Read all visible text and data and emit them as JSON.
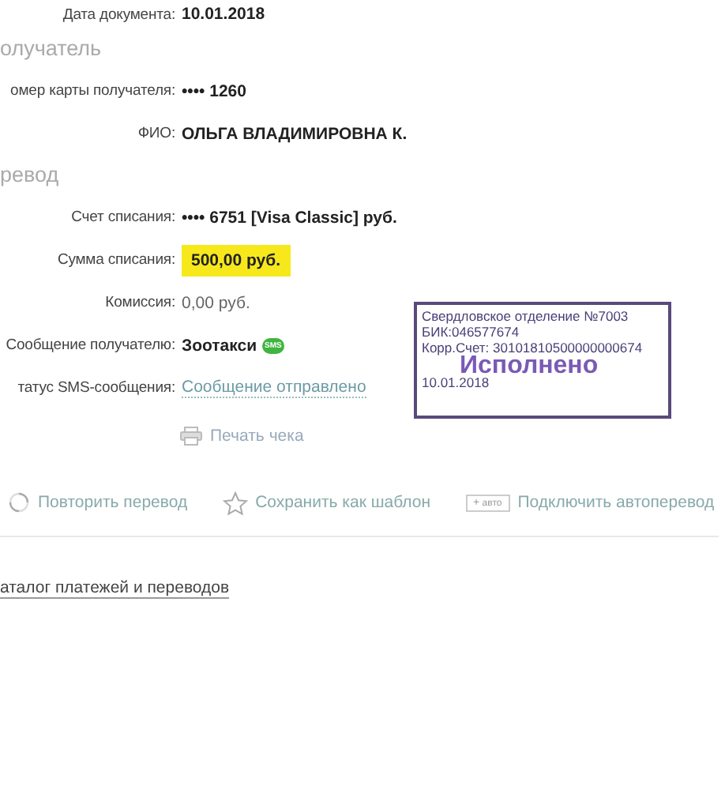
{
  "blocks": [
    {
      "kind": "text",
      "label": "Дата документа:",
      "value": "10.01.2018"
    },
    {
      "kind": "heading",
      "title": "олучатель"
    },
    {
      "kind": "text",
      "label": "омер карты получателя:",
      "value": "•••• 1260"
    },
    {
      "kind": "text",
      "label": "ФИО:",
      "value": "ОЛЬГА ВЛАДИМИРОВНА К."
    },
    {
      "kind": "heading",
      "title": "ревод"
    },
    {
      "kind": "text",
      "label": "Счет списания:",
      "value": "•••• 6751  [Visa Classic]  руб."
    },
    {
      "kind": "amount",
      "label": "Сумма списания:",
      "value": "500,00  руб."
    },
    {
      "kind": "fee",
      "label": "Комиссия:",
      "value": "0,00 руб."
    },
    {
      "kind": "message",
      "label": "Сообщение получателю:",
      "value": "Зоотакси",
      "icon_text": "SMS"
    },
    {
      "kind": "status",
      "label": "татус SMS-сообщения:",
      "value": "Сообщение отправлено"
    }
  ],
  "print": {
    "label": "Печать чека"
  },
  "actions": [
    {
      "kind": "repeat",
      "label": "Повторить перевод"
    },
    {
      "kind": "template",
      "label": "Сохранить как шаблон"
    },
    {
      "kind": "auto",
      "badge_plus": "+",
      "badge": "авто",
      "label": "Подключить автоперевод"
    }
  ],
  "catalog": {
    "label": "аталог платежей и переводов"
  },
  "stamp": {
    "lines": [
      "Свердловское отделение №7003",
      "БИК:046577674",
      "Корр.Счет: 30101810500000000674"
    ],
    "status": "Исполнено",
    "date": "10.01.2018"
  }
}
